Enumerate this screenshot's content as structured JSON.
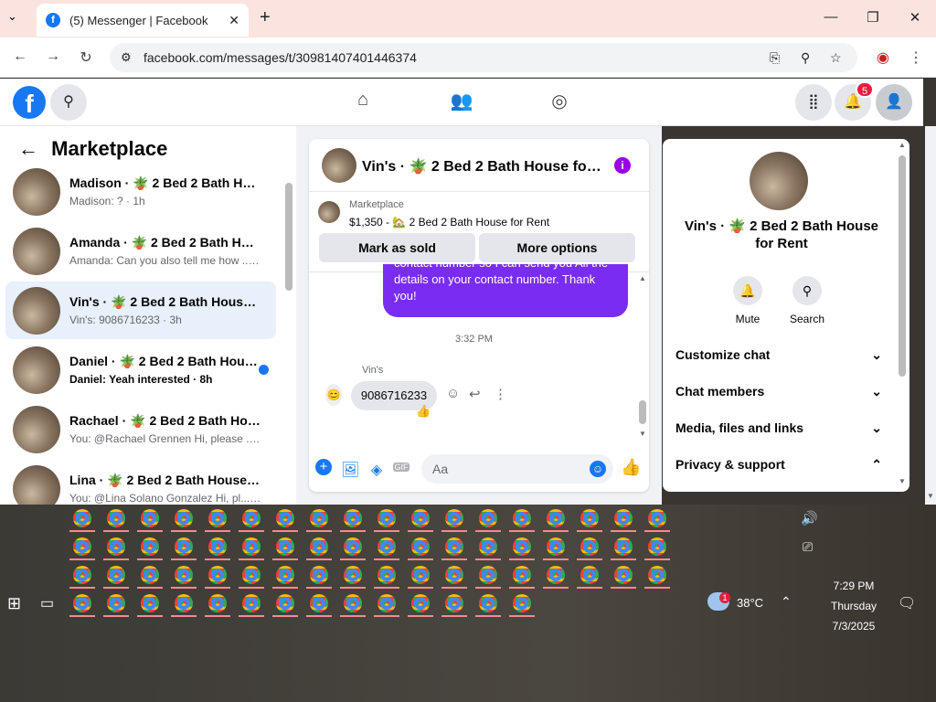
{
  "browser": {
    "tab_title": "(5) Messenger | Facebook",
    "url": "facebook.com/messages/t/30981407401446374"
  },
  "fb": {
    "notifications_count": "5"
  },
  "left": {
    "title": "Marketplace",
    "conversations": [
      {
        "name": "Madison · 🪴 2 Bed 2 Bath House...",
        "preview": "Madison: ? · 1h",
        "unread": false,
        "selected": false
      },
      {
        "name": "Amanda · 🪴 2 Bed 2 Bath Hous...",
        "preview": "Amanda: Can you also tell me how ... 3h",
        "unread": false,
        "selected": false
      },
      {
        "name": "Vin's · 🪴 2 Bed 2 Bath House fo...",
        "preview": "Vin's: 9086716233 · 3h",
        "unread": false,
        "selected": true
      },
      {
        "name": "Daniel · 🪴 2 Bed 2 Bath Hous...",
        "preview": "Daniel: Yeah interested · 8h",
        "unread": true,
        "selected": false
      },
      {
        "name": "Rachael · 🪴 2 Bed 2 Bath Hous...",
        "preview": "You: @Rachael Grennen Hi, please ... 8h",
        "unread": false,
        "selected": false
      },
      {
        "name": "Lina · 🪴 2 Bed 2 Bath House for...",
        "preview": "You: @Lina Solano Gonzalez Hi, pl... 12h",
        "unread": false,
        "selected": false
      }
    ]
  },
  "chat": {
    "title": "Vin's · 🪴 2 Bed 2 Bath House for Re...",
    "marketplace_label": "Marketplace",
    "listing": "$1,350 - 🏡 2 Bed 2 Bath House for Rent",
    "mark_sold": "Mark as sold",
    "more_options": "More options",
    "sent_message": "contact number so I can send you All the details on your contact number. Thank you!",
    "timestamp": "3:32 PM",
    "sender": "Vin's",
    "received_message": "9086716233",
    "reaction": "👍",
    "composer_placeholder": "Aa"
  },
  "right": {
    "title": "Vin's · 🪴 2 Bed 2 Bath House for Rent",
    "mute": "Mute",
    "search": "Search",
    "rows": [
      {
        "label": "Customize chat",
        "chevron": "⌄"
      },
      {
        "label": "Chat members",
        "chevron": "⌄"
      },
      {
        "label": "Media, files and links",
        "chevron": "⌄"
      },
      {
        "label": "Privacy & support",
        "chevron": "⌃"
      }
    ]
  },
  "tray": {
    "temperature": "38°C",
    "weather_badge": "1",
    "time": "7:29 PM",
    "day": "Thursday",
    "date": "7/3/2025"
  }
}
